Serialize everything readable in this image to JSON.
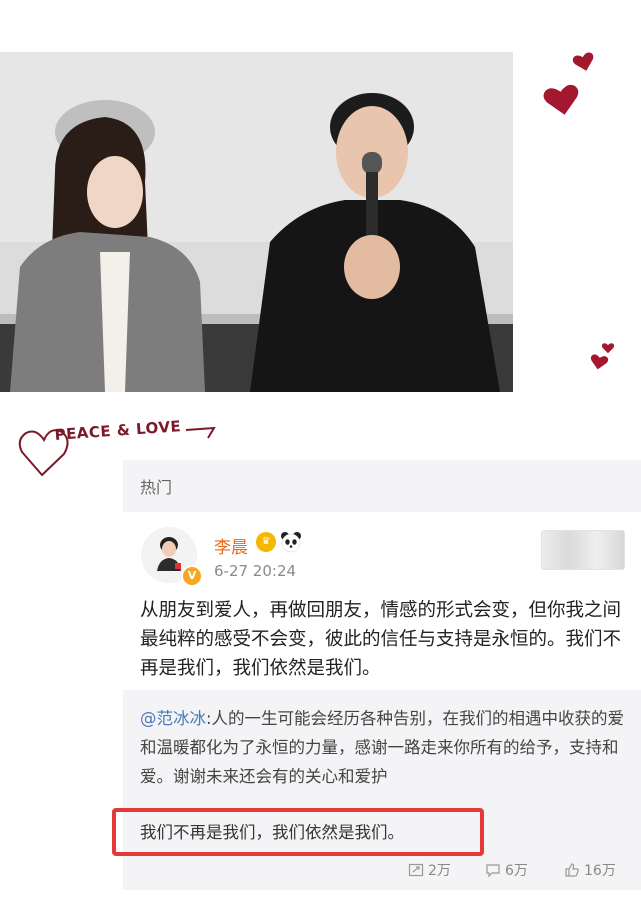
{
  "decoration": {
    "peace_text": "PEACE & LOVE",
    "heart_color": "#a3172f"
  },
  "feed": {
    "section_label": "热门"
  },
  "post": {
    "author": "李晨",
    "time": "6-27 20:24",
    "avatar_icon": "user-avatar-icon",
    "verified_badge": "V",
    "content": "从朋友到爱人，再做回朋友，情感的形式会变，但你我之间最纯粹的感受不会变，彼此的信任与支持是永恒的。我们不再是我们，我们依然是我们。",
    "repost": {
      "mention": "@范冰冰",
      "text": ":人的一生可能会经历各种告别，在我们的相遇中收获的爱和温暖都化为了永恒的力量，感谢一路走来你所有的给予，支持和爱。谢谢未来还会有的关心和爱护",
      "last_line": "我们不再是我们，我们依然是我们。"
    },
    "actions": {
      "repost_count": "2万",
      "comment_count": "6万",
      "like_count": "16万"
    },
    "accent_color": "#e86a1a",
    "link_color": "#4b7bb5",
    "highlight_color": "#e53935"
  }
}
